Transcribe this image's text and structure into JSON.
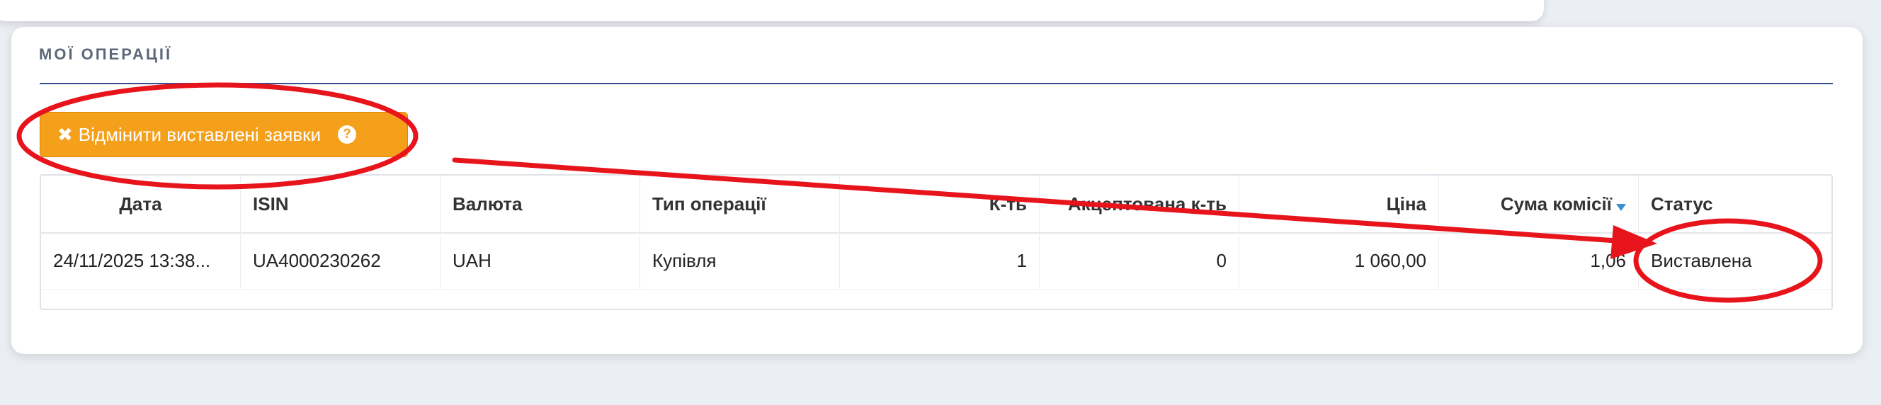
{
  "section": {
    "title": "МОЇ ОПЕРАЦІЇ"
  },
  "cancel_button": {
    "label": "Відмінити виставлені заявки",
    "icon": "close-icon",
    "help_icon": "help-icon"
  },
  "table": {
    "columns": [
      "Дата",
      "ISIN",
      "Валюта",
      "Тип операції",
      "К-ть",
      "Акцептована к-ть",
      "Ціна",
      "Сума комісії",
      "Статус"
    ],
    "sorted_column": "Сума комісії",
    "sort_direction": "descending",
    "rows": [
      {
        "date": "24/11/2025 13:38...",
        "isin": "UA4000230262",
        "currency": "UAH",
        "type": "Купівля",
        "qty": "1",
        "accepted_qty": "0",
        "price": "1 060,00",
        "commission": "1,06",
        "status": "Виставлена"
      }
    ]
  },
  "colors": {
    "accent_button": "#f5a01a",
    "annotation_red": "#e8141b",
    "rule": "#3b4f8f",
    "sort_arrow": "#3a8fd0"
  }
}
